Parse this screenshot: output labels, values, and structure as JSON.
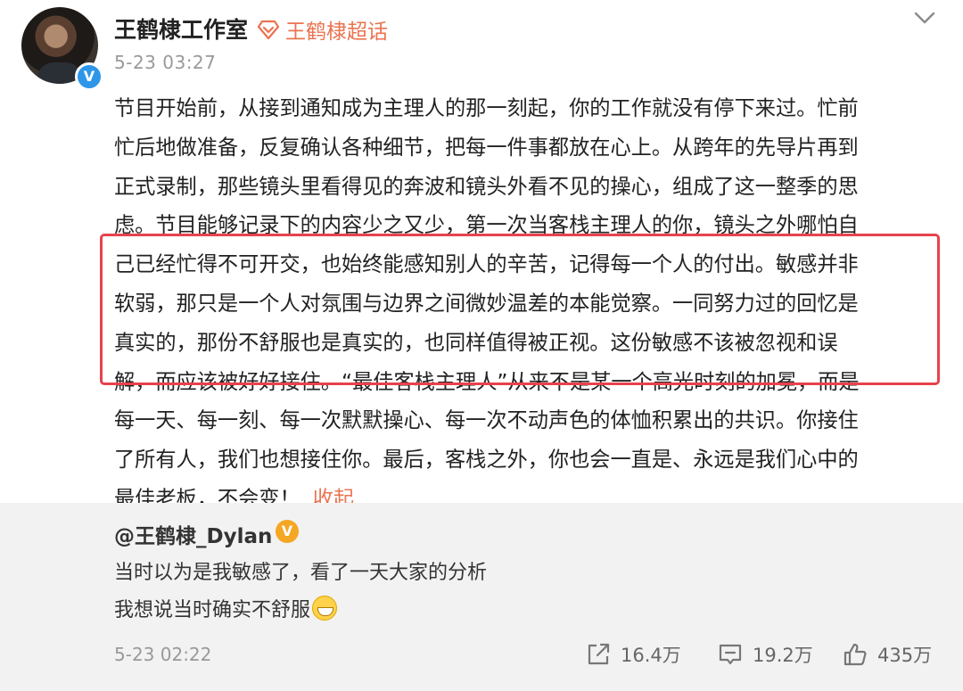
{
  "post": {
    "author": "王鹤棣工作室",
    "topic": "王鹤棣超话",
    "time": "5-23 03:27",
    "lines": [
      "节目开始前，从接到通知成为主理人的那一刻起，你的工作就没有停下来过。忙前",
      "忙后地做准备，反复确认各种细节，把每一件事都放在心上。从跨年的先导片再到",
      "正式录制，那些镜头里看得见的奔波和镜头外看不见的操心，组成了这一整季的思",
      "虑。节目能够记录下的内容少之又少，第一次当客栈主理人的你，镜头之外哪怕自",
      "己已经忙得不可开交，也始终能感知别人的辛苦，记得每一个人的付出。敏感并非",
      "软弱，那只是一个人对氛围与边界之间微妙温差的本能觉察。一同努力过的回忆是",
      "真实的，那份不舒服也是真实的，也同样值得被正视。这份敏感不该被忽视和误",
      "解，而应该被好好接住。“最佳客栈主理人”从来不是某一个高光时刻的加冕，而是",
      "每一天、每一刻、每一次默默操心、每一次不动声色的体恤积累出的共识。你接住",
      "了所有人，我们也想接住你。最后，客栈之外，你也会一直是、永远是我们心中的",
      "最佳老板，不会变！"
    ],
    "collapse_label": "收起",
    "avatar_badge": "V"
  },
  "repost": {
    "author": "@王鹤棣_Dylan",
    "badge": "V",
    "line1": "当时以为是我敏感了，看了一天大家的分析",
    "line2": "我想说当时确实不舒服",
    "emoji": "grin-emoji",
    "time": "5-23 02:22",
    "shares": "16.4万",
    "comments": "19.2万",
    "likes": "435万"
  },
  "colors": {
    "accent": "#eb7350",
    "highlight_border": "#e8424c",
    "verified_blue": "#2d96e8",
    "verified_gold": "#f5a623",
    "repost_bg": "#f2f2f2"
  }
}
